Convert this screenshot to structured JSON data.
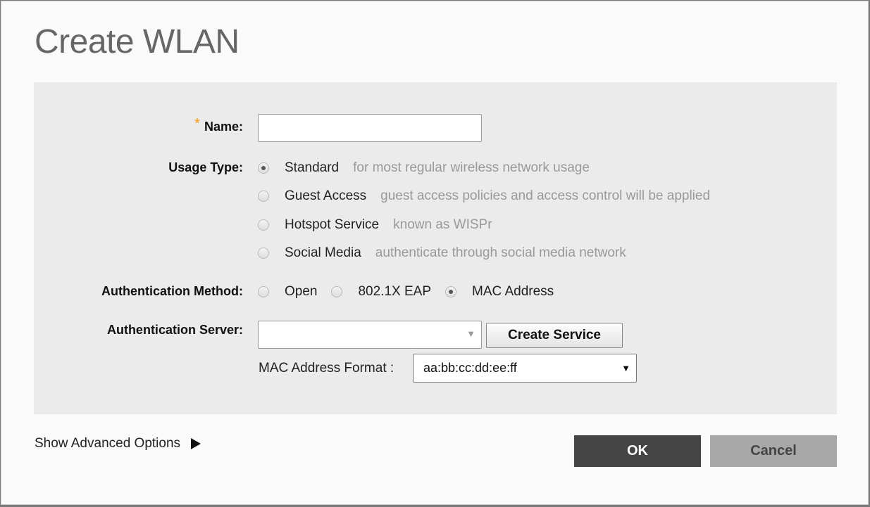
{
  "dialog": {
    "title": "Create WLAN"
  },
  "form": {
    "name": {
      "required_mark": "*",
      "label": "Name:",
      "value": ""
    },
    "usage_type": {
      "label": "Usage Type:",
      "options": [
        {
          "label": "Standard",
          "description": "for most regular wireless network usage",
          "selected": true
        },
        {
          "label": "Guest Access",
          "description": "guest access policies and access control will be applied",
          "selected": false
        },
        {
          "label": "Hotspot Service",
          "description": "known as WISPr",
          "selected": false
        },
        {
          "label": "Social Media",
          "description": "authenticate through social media network",
          "selected": false
        }
      ]
    },
    "auth_method": {
      "label": "Authentication Method:",
      "options": [
        {
          "label": "Open",
          "selected": false
        },
        {
          "label": "802.1X EAP",
          "selected": false
        },
        {
          "label": "MAC Address",
          "selected": true
        }
      ]
    },
    "auth_server": {
      "label": "Authentication Server:",
      "value": "",
      "dropdown_icon": "dropdown-arrow-icon",
      "create_button": "Create Service"
    },
    "mac_format": {
      "label": "MAC Address Format :",
      "value": "aa:bb:cc:dd:ee:ff",
      "dropdown_icon": "dropdown-arrow-icon"
    }
  },
  "footer": {
    "advanced_label": "Show Advanced Options",
    "advanced_icon": "triangle-right-icon",
    "ok_label": "OK",
    "cancel_label": "Cancel"
  },
  "colors": {
    "required_mark": "#f39c12",
    "ok_bg": "#444444",
    "cancel_bg": "#a8a8a8",
    "panel_bg": "#ebebeb"
  }
}
